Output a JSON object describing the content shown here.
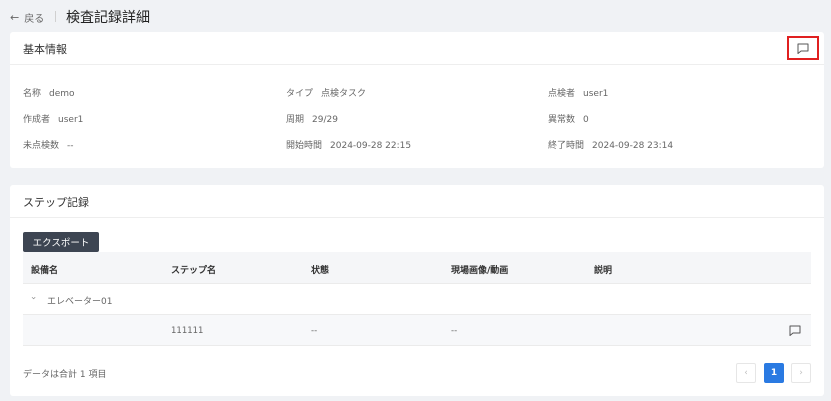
{
  "nav": {
    "back_label": "戻る",
    "page_title": "検査記録詳細"
  },
  "basic": {
    "title": "基本情報",
    "fields": {
      "name_label": "名称",
      "name_value": "demo",
      "type_label": "タイプ",
      "type_value": "点検タスク",
      "inspector_label": "点検者",
      "inspector_value": "user1",
      "creator_label": "作成者",
      "creator_value": "user1",
      "cycle_label": "周期",
      "cycle_value": "29/29",
      "abnormal_label": "異常数",
      "abnormal_value": "0",
      "unchecked_label": "未点検数",
      "unchecked_value": "--",
      "start_label": "開始時間",
      "start_value": "2024-09-28 22:15",
      "end_label": "終了時間",
      "end_value": "2024-09-28 23:14"
    }
  },
  "steps": {
    "title": "ステップ記録",
    "export_label": "エクスポート",
    "columns": {
      "device": "設備名",
      "step": "ステップ名",
      "status": "状態",
      "media": "現場画像/動画",
      "note": "説明"
    },
    "group": {
      "name": "エレベーター01"
    },
    "row": {
      "step": "111111",
      "status": "--",
      "media": "--"
    },
    "total_text": "データは合計 1 項目",
    "pagination": {
      "prev": "‹",
      "current": "1",
      "next": "›"
    }
  },
  "colors": {
    "accent": "#2a7ae2",
    "highlight_border": "#e02020",
    "export_bg": "#3d4552"
  },
  "icons": {
    "back": "arrow-left-icon",
    "comment": "comment-icon",
    "expand": "chevron-right-icon"
  }
}
